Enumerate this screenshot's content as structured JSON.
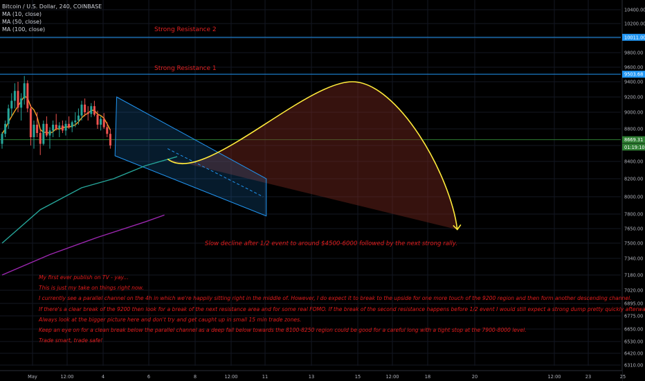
{
  "header": {
    "symbol_line": "Bitcoin / U.S. Dollar, 240, COINBASE",
    "indicators": [
      "MA (10, close)",
      "MA (50, close)",
      "MA (100, close)"
    ]
  },
  "colors": {
    "background": "#000000",
    "resistance_line": "#2196f3",
    "support_line": "#2e7d32",
    "ma10": "#f5a623",
    "ma50": "#26a69a",
    "ma100": "#9c27b0",
    "candle_up": "#26a69a",
    "candle_down": "#ef5350",
    "channel": "#2196f3",
    "projection": "#ffeb3b",
    "annotation_text": "#e51c1c"
  },
  "chart_data": {
    "type": "candlestick",
    "ylim": [
      6260,
      10480
    ],
    "y_ticks": [
      10400,
      10200,
      10000,
      9800,
      9600,
      9400,
      9200,
      9000,
      8800,
      8600,
      8400,
      8200,
      8000,
      7800,
      7650,
      7500,
      7340,
      7180,
      7020,
      6895,
      6775,
      6650,
      6530,
      6420,
      6310
    ],
    "y_tick_labels": [
      "10400.00",
      "10200.00",
      "10000.00",
      "9800.00",
      "9600.00",
      "9400.00",
      "9200.00",
      "9000.00",
      "8800.00",
      "8600.00",
      "8400.00",
      "8200.00",
      "8000.00",
      "7800.00",
      "7650.00",
      "7500.00",
      "7340.00",
      "7180.00",
      "7020.00",
      "6895.00",
      "6775.00",
      "6650.00",
      "6530.00",
      "6420.00",
      "6310.00"
    ],
    "x_tick_labels": [
      "May",
      "12:00",
      "4",
      "6",
      "8",
      "12:00",
      "11",
      "13",
      "15",
      "12:00",
      "18",
      "20",
      "12:00",
      "23",
      "25"
    ],
    "price_tags": [
      {
        "label": "10011.00",
        "value": 10011,
        "color": "#2196f3"
      },
      {
        "label": "9503.68",
        "value": 9503.68,
        "color": "#2196f3"
      },
      {
        "label": "8669.31",
        "value": 8669.31,
        "color": "#2e7d32"
      },
      {
        "label": "01:19:10",
        "value": 8580,
        "color": "#2e7d32"
      }
    ],
    "horizontal_lines": [
      {
        "name": "Strong Resistance 2",
        "value": 10011
      },
      {
        "name": "Strong Resistance 1",
        "value": 9503.68
      },
      {
        "name": "",
        "value": 8669.31
      }
    ],
    "candles": [
      [
        8620,
        8760,
        8560,
        8740
      ],
      [
        8740,
        8900,
        8700,
        8860
      ],
      [
        8860,
        9100,
        8800,
        9050
      ],
      [
        9050,
        9250,
        8950,
        9150
      ],
      [
        9150,
        9380,
        9050,
        9280
      ],
      [
        9280,
        9400,
        9000,
        9060
      ],
      [
        9060,
        9250,
        8900,
        9180
      ],
      [
        9180,
        9480,
        9100,
        9380
      ],
      [
        9380,
        9420,
        9000,
        9050
      ],
      [
        9050,
        9100,
        8600,
        8700
      ],
      [
        8700,
        8900,
        8560,
        8850
      ],
      [
        8850,
        9000,
        8700,
        8750
      ],
      [
        8750,
        8800,
        8480,
        8620
      ],
      [
        8620,
        8900,
        8600,
        8860
      ],
      [
        8860,
        8950,
        8700,
        8720
      ],
      [
        8720,
        8820,
        8560,
        8780
      ],
      [
        8780,
        8900,
        8700,
        8850
      ],
      [
        8850,
        8980,
        8780,
        8800
      ],
      [
        8800,
        8880,
        8700,
        8840
      ],
      [
        8840,
        8900,
        8750,
        8780
      ],
      [
        8780,
        8900,
        8720,
        8860
      ],
      [
        8860,
        8950,
        8800,
        8820
      ],
      [
        8820,
        8900,
        8760,
        8880
      ],
      [
        8880,
        9000,
        8820,
        8900
      ],
      [
        8900,
        9050,
        8850,
        8960
      ],
      [
        8960,
        9150,
        8900,
        9100
      ],
      [
        9100,
        9180,
        8950,
        9000
      ],
      [
        9000,
        9080,
        8900,
        8980
      ],
      [
        8980,
        9120,
        8940,
        9080
      ],
      [
        9080,
        9150,
        8950,
        8970
      ],
      [
        8970,
        9020,
        8800,
        8850
      ],
      [
        8850,
        8950,
        8780,
        8920
      ],
      [
        8920,
        8990,
        8800,
        8820
      ],
      [
        8820,
        8880,
        8700,
        8740
      ],
      [
        8740,
        8800,
        8560,
        8600
      ]
    ],
    "ma50": [
      [
        0,
        7500
      ],
      [
        12,
        7850
      ],
      [
        25,
        8100
      ],
      [
        35,
        8200
      ],
      [
        45,
        8350
      ],
      [
        55,
        8460
      ]
    ],
    "ma100": [
      [
        0,
        7180
      ],
      [
        15,
        7380
      ],
      [
        30,
        7560
      ],
      [
        45,
        7720
      ],
      [
        51,
        7790
      ]
    ],
    "channel": {
      "upper": [
        [
          36,
          9200
        ],
        [
          83,
          8200
        ]
      ],
      "lower": [
        [
          47,
          8540
        ],
        [
          83,
          7780
        ]
      ],
      "mid": [
        [
          52,
          8560
        ],
        [
          82,
          8000
        ]
      ]
    },
    "projection": {
      "start": [
        52,
        8430
      ],
      "peak": [
        110,
        9400
      ],
      "end": [
        143,
        7640
      ]
    },
    "wedge_bottom": {
      "from": [
        52,
        8430
      ],
      "to": [
        143,
        7640
      ]
    }
  },
  "annotations": {
    "resistance2": "Strong Resistance 2",
    "resistance1": "Strong Resistance 1",
    "slow_decline": "Slow decline after 1/2 event to around $4500-6000 followed by the next strong rally.",
    "notes": [
      "My first ever publish on TV - yay...",
      "This is just my take on things right now.",
      "I currently see a parallel channel on the 4h in which we're happily sitting right in the middle of.  However, I do expect it to break to the upside for one more touch of the 9200 region and then form another descending channel.",
      "If there's a clear break of the 9200 then look for a break of the next resistance area and for some real FOMO.  If the break of the second resistance happens before 1/2 event I would still expect a strong dump pretty quickly afterwards.",
      "Always look at the bigger picture here and don't try and get caught up in small 15 min trade zones.",
      "Keep an eye on for a clean break below the parallel channel as a deep fall below towards the 8100-8250 region could be good for a careful long with a tight stop at the 7900-8000 level.",
      "Trade smart, trade safe!"
    ]
  }
}
